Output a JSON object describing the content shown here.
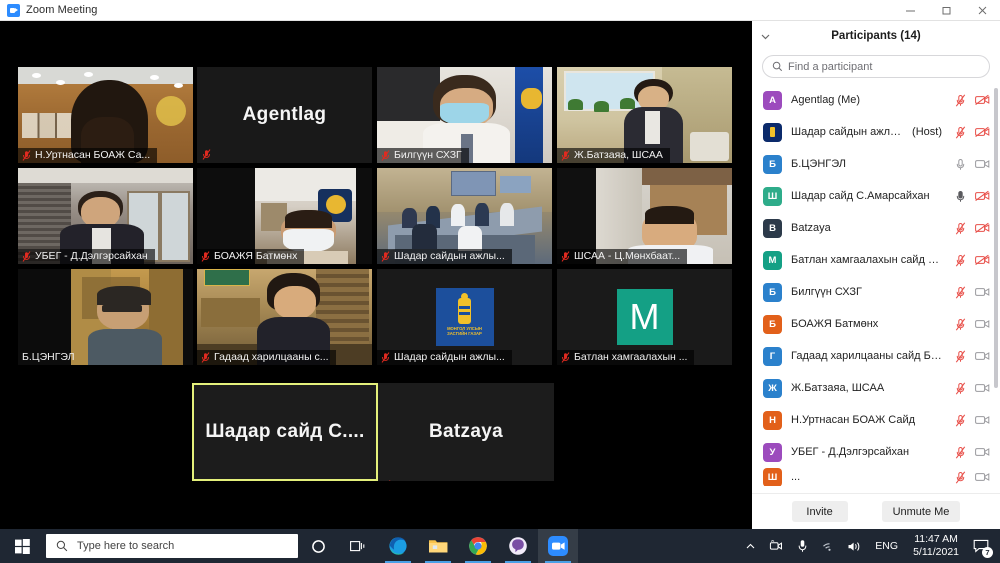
{
  "window": {
    "title": "Zoom Meeting",
    "app_icon": "zoom-camera-icon",
    "minimize_label": "Minimize",
    "maximize_label": "Restore",
    "close_label": "Close"
  },
  "stage": {
    "tiles": [
      {
        "name": "Н.Уртнасан БОАЖ Са...",
        "muted": true,
        "display": "video",
        "scene": "office-woman-back",
        "row": 0,
        "col": 0
      },
      {
        "name": "Agentlag",
        "muted": true,
        "display": "name-center",
        "scene": "dark",
        "row": 0,
        "col": 1
      },
      {
        "name": "Билгүүн СХЗГ",
        "muted": true,
        "display": "video",
        "scene": "masked-man-flag",
        "row": 0,
        "col": 2
      },
      {
        "name": "Ж.Батзаяа, ШСАА",
        "muted": true,
        "display": "video",
        "scene": "woman-window-plants",
        "row": 0,
        "col": 3
      },
      {
        "name": "УБЕГ - Д.Дэлгэрсайхан",
        "muted": true,
        "display": "video",
        "scene": "man-suit-office",
        "row": 1,
        "col": 0
      },
      {
        "name": "БОАЖЯ Батмөнх",
        "muted": true,
        "display": "video",
        "scene": "masked-man-room",
        "row": 1,
        "col": 1
      },
      {
        "name": "Шадар сайдын ажлы...",
        "muted": true,
        "display": "video",
        "scene": "conference-room",
        "row": 1,
        "col": 2
      },
      {
        "name": "ШСАА - Ц.Мөнхбаат...",
        "muted": true,
        "display": "video",
        "scene": "man-curtain",
        "row": 1,
        "col": 3
      },
      {
        "name": "Б.ЦЭНГЭЛ",
        "muted": false,
        "display": "video",
        "scene": "man-glasses",
        "row": 2,
        "col": 0
      },
      {
        "name": "Гадаад харилцааны с...",
        "muted": true,
        "display": "video",
        "scene": "woman-bookshelf",
        "row": 2,
        "col": 1
      },
      {
        "name": "Шадар сайдын ажлы...",
        "muted": true,
        "display": "avatar-image",
        "scene": "mongolia-gov-emblem",
        "row": 2,
        "col": 2
      },
      {
        "name": "Батлан хамгаалахын ...",
        "muted": true,
        "display": "avatar-letter",
        "avatar_letter": "M",
        "avatar_color": "#14a085",
        "row": 2,
        "col": 3
      },
      {
        "name": "Шадар сайд С....",
        "muted": false,
        "display": "name-center",
        "scene": "dark",
        "selected": true,
        "row": 3,
        "col": 1
      },
      {
        "name": "Batzaya",
        "muted": true,
        "display": "name-center",
        "scene": "dark",
        "row": 3,
        "col": 2
      }
    ],
    "emblem_text_line1": "МОНГОЛ УЛСЫН",
    "emblem_text_line2": "ЗАСГИЙН ГАЗАР"
  },
  "panel": {
    "title": "Participants (14)",
    "collapse_icon": "chevron-down-icon",
    "search_placeholder": "Find a participant",
    "search_value": "",
    "search_icon": "search-icon",
    "host_tag": "(Host)",
    "invite_label": "Invite",
    "unmute_label": "Unmute Me",
    "participants": [
      {
        "name": "Agentlag (Me)",
        "initial": "A",
        "color": "#9c4bbd",
        "mic": "muted",
        "video": "off",
        "avatar_type": "letter"
      },
      {
        "name": "Шадар сайдын ажлын а...",
        "initial": "",
        "color": "#0b2a6b",
        "mic": "muted",
        "video": "off",
        "host": true,
        "avatar_type": "emblem"
      },
      {
        "name": "Б.ЦЭНГЭЛ",
        "initial": "Б",
        "color": "#2b81cc",
        "mic": "on",
        "video": "on",
        "avatar_type": "letter"
      },
      {
        "name": "Шадар сайд С.Амарсайхан",
        "initial": "Ш",
        "color": "#2eac8a",
        "mic": "on-dark",
        "video": "off",
        "avatar_type": "letter"
      },
      {
        "name": "Batzaya",
        "initial": "B",
        "color": "#2c3a4a",
        "mic": "muted",
        "video": "off",
        "avatar_type": "letter"
      },
      {
        "name": "Батлан хамгаалахын сайд Г.Са...",
        "initial": "M",
        "color": "#14a085",
        "mic": "muted",
        "video": "off",
        "avatar_type": "letter"
      },
      {
        "name": "Билгүүн СХЗГ",
        "initial": "Б",
        "color": "#2b81cc",
        "mic": "muted",
        "video": "on",
        "avatar_type": "letter"
      },
      {
        "name": "БОАЖЯ Батмөнх",
        "initial": "Б",
        "color": "#e2601a",
        "mic": "muted",
        "video": "on",
        "avatar_type": "letter"
      },
      {
        "name": "Гадаад харилцааны сайд Б.Бат...",
        "initial": "Г",
        "color": "#2b81cc",
        "mic": "muted",
        "video": "on",
        "avatar_type": "letter"
      },
      {
        "name": "Ж.Батзаяа, ШСАА",
        "initial": "Ж",
        "color": "#2b81cc",
        "mic": "muted",
        "video": "on",
        "avatar_type": "letter"
      },
      {
        "name": "Н.Уртнасан БОАЖ Сайд",
        "initial": "Н",
        "color": "#e2601a",
        "mic": "muted",
        "video": "on",
        "avatar_type": "letter"
      },
      {
        "name": "УБЕГ - Д.Дэлгэрсайхан",
        "initial": "У",
        "color": "#9c4bbd",
        "mic": "muted",
        "video": "on",
        "avatar_type": "letter"
      },
      {
        "name": "...",
        "initial": "Ш",
        "color": "#e2601a",
        "mic": "muted",
        "video": "on",
        "avatar_type": "letter"
      }
    ]
  },
  "taskbar": {
    "start_label": "Start",
    "search_placeholder": "Type here to search",
    "search_icon": "magnifier-icon",
    "cortana_icon": "cortana-circle-icon",
    "taskview_icon": "task-view-icon",
    "apps": [
      {
        "name": "Microsoft Edge",
        "icon": "edge-icon",
        "open": true
      },
      {
        "name": "File Explorer",
        "icon": "folder-icon",
        "open": true
      },
      {
        "name": "Google Chrome",
        "icon": "chrome-icon",
        "open": true
      },
      {
        "name": "Viber",
        "icon": "viber-icon",
        "open": true
      },
      {
        "name": "Zoom",
        "icon": "zoom-icon",
        "open": true,
        "active": true
      }
    ],
    "tray": {
      "overflow_icon": "chevron-up-icon",
      "camera_icon": "camera-icon",
      "mic_icon": "microphone-icon",
      "network_icon": "wifi-icon",
      "volume_icon": "speaker-icon",
      "language": "ENG",
      "time": "11:47 AM",
      "date": "5/11/2021",
      "notification_icon": "action-center-icon",
      "notification_count": "7"
    }
  }
}
